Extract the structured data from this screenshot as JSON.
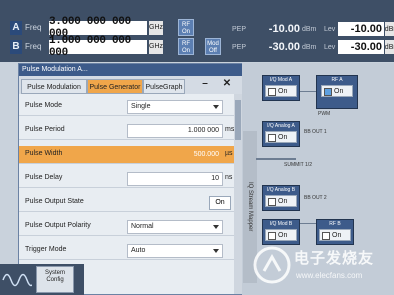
{
  "header": {
    "row_a": {
      "label": "A",
      "sub": "Freq",
      "value": "3.000 000 000 000",
      "unit": "GHz"
    },
    "row_b": {
      "label": "B",
      "sub": "Freq",
      "value": "1.000 000 000 000",
      "unit": "GHz"
    },
    "rf_a_button": "RF On",
    "rf_b_button": "RF On",
    "mod_button": "Mod Off",
    "pep_a": {
      "label": "PEP",
      "value": "-10.00",
      "unit": "dBm"
    },
    "pep_b": {
      "label": "PEP",
      "value": "-30.00",
      "unit": "dBm"
    },
    "level_a": {
      "label": "Lev",
      "value": "-10.00",
      "unit": "dBm"
    },
    "level_b": {
      "label": "Lev",
      "value": "-30.00",
      "unit": "dBm"
    }
  },
  "dialog": {
    "title": "Pulse Modulation A...",
    "tabs": [
      "Pulse Modulation",
      "Pulse Generator",
      "PulseGraph"
    ],
    "active_tab": "Pulse Generator",
    "fields": [
      {
        "label": "Pulse Mode",
        "value": "Single",
        "unit": ""
      },
      {
        "label": "Pulse Period",
        "value": "1.000 000",
        "unit": "ms"
      },
      {
        "label": "Pulse Width",
        "value": "500.000",
        "unit": "µs"
      },
      {
        "label": "Pulse Delay",
        "value": "10",
        "unit": "ns"
      },
      {
        "label": "Pulse Output State",
        "value": "On",
        "unit": ""
      },
      {
        "label": "Pulse Output Polarity",
        "value": "Normal",
        "unit": ""
      },
      {
        "label": "Trigger Mode",
        "value": "Auto",
        "unit": ""
      }
    ]
  },
  "diagram": {
    "stream_label": "IQ Stream Mapper",
    "blocks": [
      {
        "title": "I/Q Mod A",
        "state": "On"
      },
      {
        "title": "RF A",
        "state": "On"
      },
      {
        "title": "I/Q Analog A",
        "state": "On"
      },
      {
        "title": "I/Q Analog B",
        "state": "On"
      },
      {
        "title": "I/Q Mod B",
        "state": "On"
      },
      {
        "title": "RF B",
        "state": "On"
      }
    ],
    "labels": [
      "BB OUT 1",
      "BB OUT 2",
      "SUMMIT 1/2",
      "PWM"
    ]
  },
  "bottom": {
    "system_button": "System Config"
  },
  "watermark": {
    "text": "电子发烧友",
    "sub": "www.elecfans.com"
  }
}
